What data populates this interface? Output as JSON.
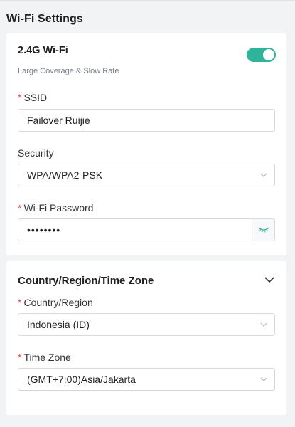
{
  "page": {
    "title": "Wi-Fi Settings"
  },
  "wifi": {
    "band_title": "2.4G Wi-Fi",
    "description": "Large Coverage & Slow Rate",
    "enabled": true,
    "ssid": {
      "label": "SSID",
      "required_mark": "*",
      "value": "Failover Ruijie"
    },
    "security": {
      "label": "Security",
      "value": "WPA/WPA2-PSK"
    },
    "password": {
      "label": "Wi-Fi Password",
      "required_mark": "*",
      "masked_value": "••••••••"
    }
  },
  "region": {
    "section_title": "Country/Region/Time Zone",
    "country": {
      "label": "Country/Region",
      "required_mark": "*",
      "value": "Indonesia (ID)"
    },
    "timezone": {
      "label": "Time Zone",
      "required_mark": "*",
      "value": "(GMT+7:00)Asia/Jakarta"
    }
  },
  "colors": {
    "accent": "#2fb39a",
    "required": "#e34a4a"
  },
  "icons": {
    "toggle": "toggle-switch",
    "select_arrow": "chevron-down-icon",
    "password_visibility": "eye-closed-icon",
    "section_collapse": "chevron-down-icon"
  }
}
